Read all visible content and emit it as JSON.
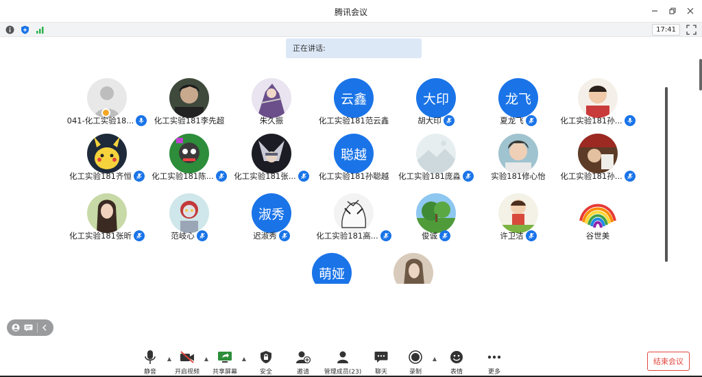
{
  "window": {
    "title": "腾讯会议"
  },
  "status": {
    "time": "17:41"
  },
  "speaking": {
    "label": "正在讲话:"
  },
  "participants": [
    {
      "name": "041-化工实验18...",
      "avatar": "photo",
      "host": true
    },
    {
      "name": "化工实验181李先超",
      "avatar": "photo"
    },
    {
      "name": "朱久振",
      "avatar": "photo"
    },
    {
      "name": "化工实验181范云鑫",
      "avatar_text": "云鑫"
    },
    {
      "name": "胡大印",
      "avatar_text": "大印"
    },
    {
      "name": "夏龙飞",
      "avatar_text": "龙飞"
    },
    {
      "name": "化工实验181孙...",
      "avatar": "photo"
    },
    {
      "name": "化工实验181齐恒",
      "avatar": "photo"
    },
    {
      "name": "化工实验181陈...",
      "avatar": "photo"
    },
    {
      "name": "化工实验181张...",
      "avatar": "photo"
    },
    {
      "name": "化工实验181孙聪越",
      "avatar_text": "聪越"
    },
    {
      "name": "化工实验181庞淼",
      "avatar": "photo"
    },
    {
      "name": "实验181修心怡",
      "avatar": "photo"
    },
    {
      "name": "化工实验181孙...",
      "avatar": "photo"
    },
    {
      "name": "化工实验181张昕",
      "avatar": "photo"
    },
    {
      "name": "范岐心",
      "avatar": "photo"
    },
    {
      "name": "迟淑秀",
      "avatar_text": "淑秀"
    },
    {
      "name": "化工实验181高...",
      "avatar": "photo"
    },
    {
      "name": "俊诚",
      "avatar": "photo"
    },
    {
      "name": "许卫洁",
      "avatar": "photo"
    },
    {
      "name": "谷世美",
      "avatar": "photo"
    },
    {
      "name": "",
      "avatar_text": "萌娅"
    },
    {
      "name": "",
      "avatar": "photo"
    }
  ],
  "toolbar": {
    "mute": "静音",
    "video": "开启视频",
    "share": "共享屏幕",
    "security": "安全",
    "invite": "邀请",
    "members": "管理成员(23)",
    "chat": "聊天",
    "record": "录制",
    "emoji": "表情",
    "more": "更多",
    "end": "结束会议"
  },
  "colors": {
    "accent": "#1a74e8",
    "end": "#e0463e"
  }
}
